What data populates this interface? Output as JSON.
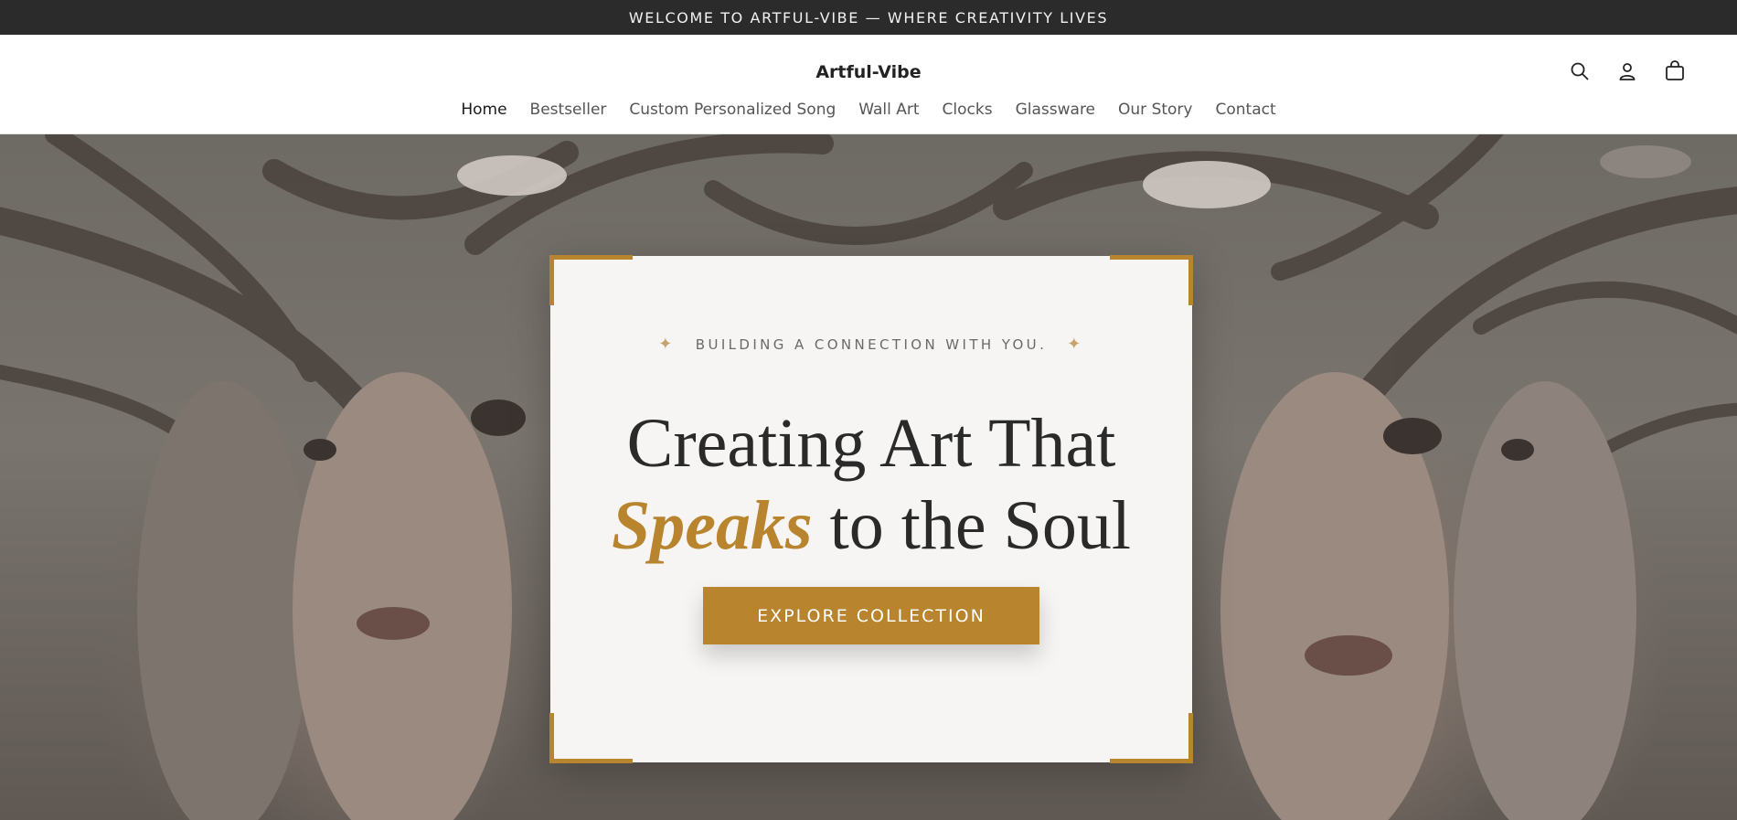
{
  "announcement": {
    "text": "WELCOME TO ARTFUL-VIBE — WHERE CREATIVITY LIVES"
  },
  "header": {
    "logo": "Artful-Vibe",
    "nav": [
      {
        "label": "Home",
        "active": true
      },
      {
        "label": "Bestseller"
      },
      {
        "label": "Custom Personalized Song"
      },
      {
        "label": "Wall Art"
      },
      {
        "label": "Clocks"
      },
      {
        "label": "Glassware"
      },
      {
        "label": "Our Story"
      },
      {
        "label": "Contact"
      }
    ],
    "icons": [
      "search-icon",
      "account-icon",
      "cart-icon"
    ]
  },
  "hero": {
    "eyebrow": "BUILDING A CONNECTION WITH YOU.",
    "headline_line1": "Creating Art That",
    "headline_accent": "Speaks",
    "headline_rest": "to the Soul",
    "cta_label": "EXPLORE COLLECTION",
    "accent_color": "#b8842e",
    "background_description_icon": "artwork-faces-branches"
  }
}
